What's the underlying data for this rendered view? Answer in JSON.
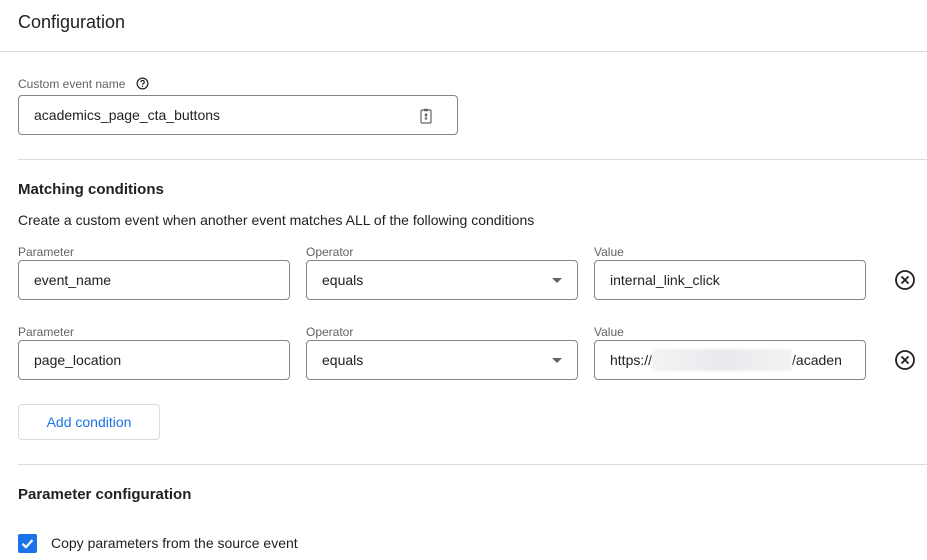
{
  "header": {
    "title": "Configuration"
  },
  "custom_event": {
    "label": "Custom event name",
    "value": "academics_page_cta_buttons"
  },
  "matching": {
    "title": "Matching conditions",
    "description": "Create a custom event when another event matches ALL of the following conditions",
    "labels": {
      "parameter": "Parameter",
      "operator": "Operator",
      "value": "Value"
    },
    "conditions": [
      {
        "parameter": "event_name",
        "operator": "equals",
        "value": "internal_link_click"
      },
      {
        "parameter": "page_location",
        "operator": "equals",
        "value_prefix": "https://",
        "value_suffix": "/acaden"
      }
    ],
    "add_condition_label": "Add condition"
  },
  "parameter_config": {
    "title": "Parameter configuration",
    "copy_label": "Copy parameters from the source event",
    "copy_checked": true
  },
  "colors": {
    "accent": "#1a73e8",
    "border": "#80868b",
    "divider": "#dadce0"
  }
}
